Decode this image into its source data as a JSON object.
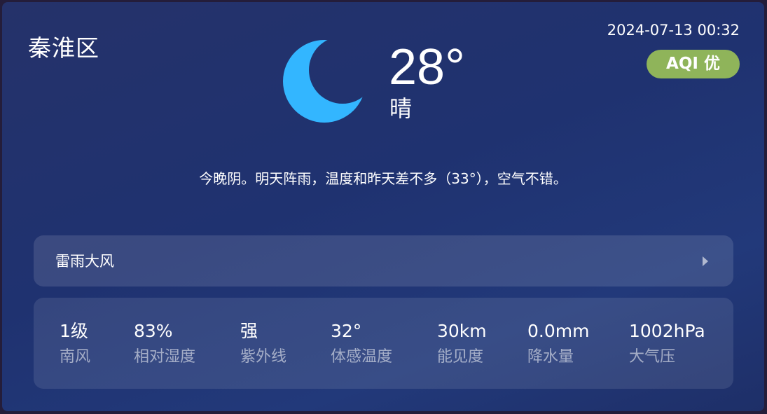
{
  "header": {
    "location": "秦淮区",
    "datetime": "2024-07-13 00:32",
    "aqi_badge": "AQI 优"
  },
  "current": {
    "icon": "crescent-moon-icon",
    "icon_color": "#33b6ff",
    "temperature": "28°",
    "condition": "晴"
  },
  "summary": "今晚阴。明天阵雨，温度和昨天差不多（33°），空气不错。",
  "alert": {
    "text": "雷雨大风",
    "arrow_icon": "chevron-right-icon"
  },
  "metrics": [
    {
      "value": "1级",
      "label": "南风"
    },
    {
      "value": "83%",
      "label": "相对湿度"
    },
    {
      "value": "强",
      "label": "紫外线"
    },
    {
      "value": "32°",
      "label": "体感温度"
    },
    {
      "value": "30km",
      "label": "能见度"
    },
    {
      "value": "0.0mm",
      "label": "降水量"
    },
    {
      "value": "1002hPa",
      "label": "大气压"
    }
  ],
  "colors": {
    "aqi_good": "#8fb45a",
    "moon": "#33b6ff"
  }
}
